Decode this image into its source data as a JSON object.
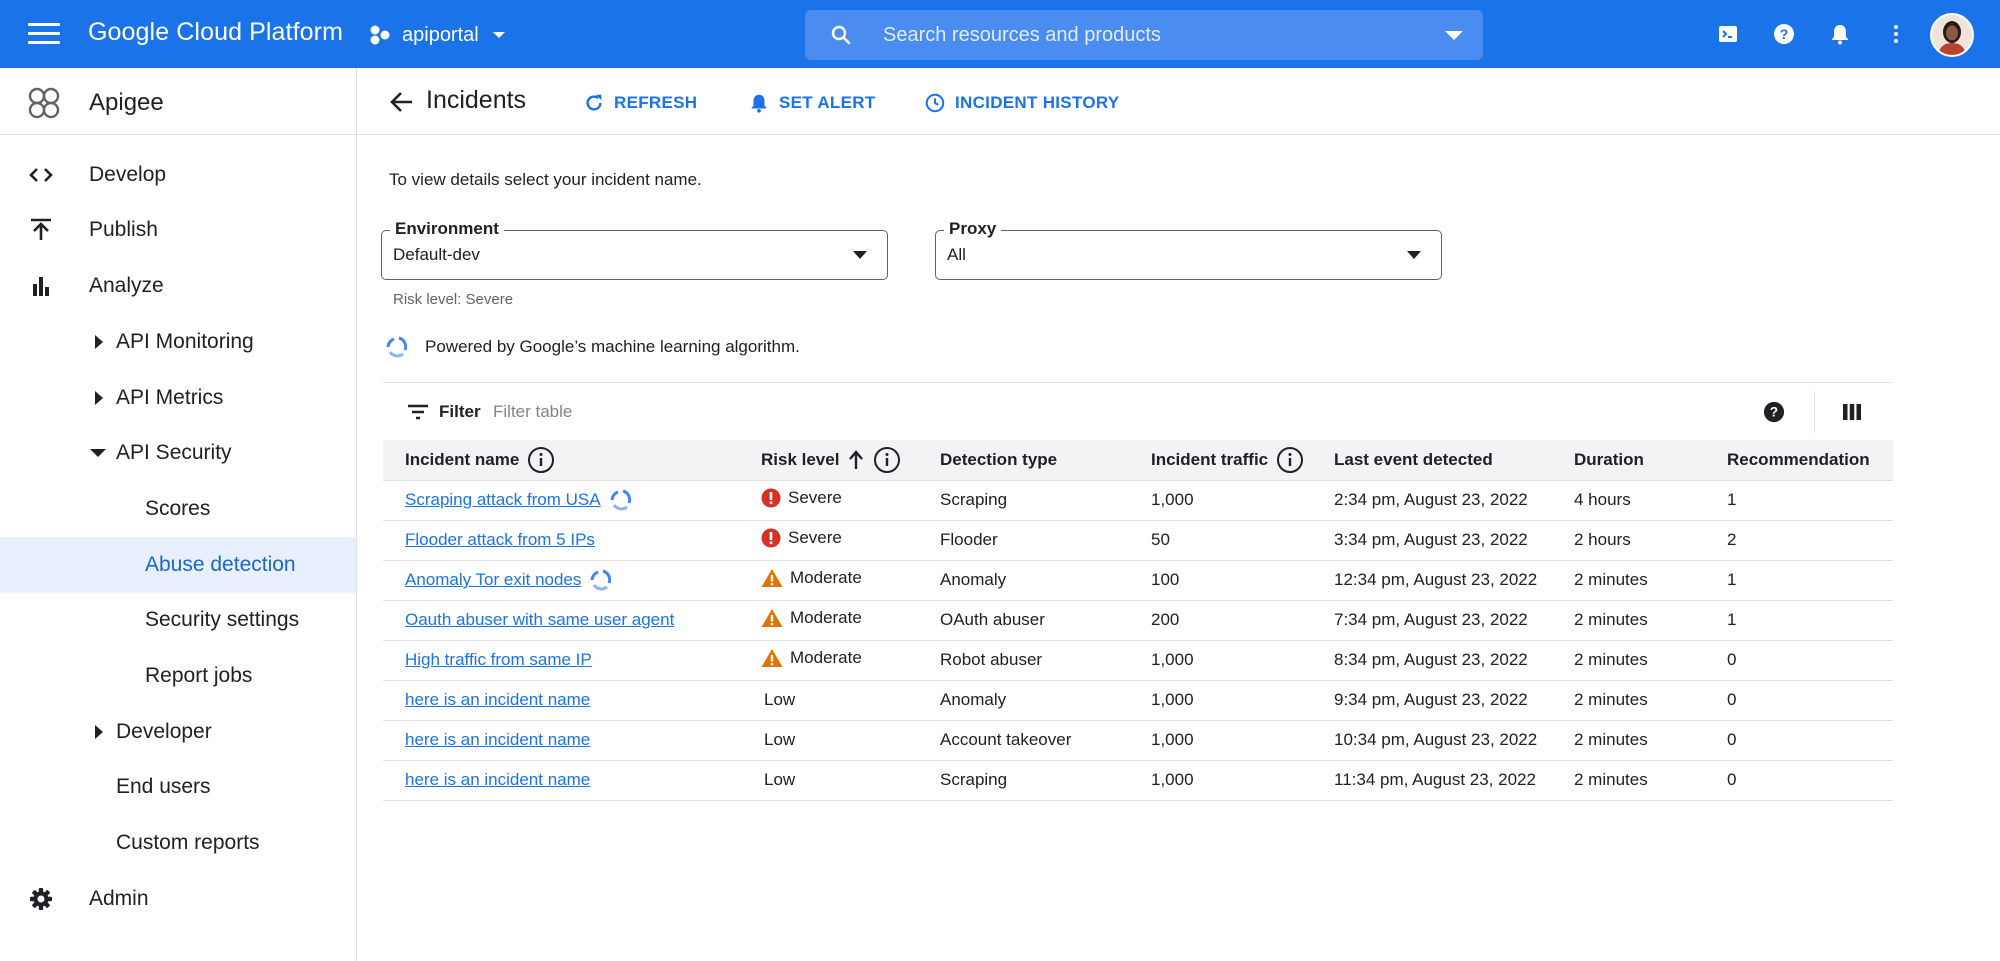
{
  "topbar": {
    "brand": "Google Cloud Platform",
    "project": "apiportal",
    "search_placeholder": "Search resources and products"
  },
  "sidebar": {
    "title": "Apigee",
    "items": [
      {
        "label": "Develop",
        "icon": "code-icon"
      },
      {
        "label": "Publish",
        "icon": "publish-icon"
      },
      {
        "label": "Analyze",
        "icon": "bar-chart-icon"
      },
      {
        "label": "API Monitoring",
        "arrow": "right"
      },
      {
        "label": "API Metrics",
        "arrow": "right"
      },
      {
        "label": "API Security",
        "arrow": "down"
      },
      {
        "label": "Scores"
      },
      {
        "label": "Abuse detection",
        "active": true
      },
      {
        "label": "Security settings"
      },
      {
        "label": "Report jobs"
      },
      {
        "label": "Developer",
        "arrow": "right"
      },
      {
        "label": "End users"
      },
      {
        "label": "Custom reports"
      },
      {
        "label": "Admin",
        "icon": "gear-icon"
      }
    ]
  },
  "header": {
    "title": "Incidents",
    "refresh": "REFRESH",
    "set_alert": "SET ALERT",
    "incident_history": "INCIDENT HISTORY"
  },
  "intro": "To view details  select your incident name.",
  "environment": {
    "label": "Environment",
    "value": "Default-dev",
    "helper": "Risk level: Severe"
  },
  "proxy": {
    "label": "Proxy",
    "value": "All"
  },
  "ml_note": "Powered by Google’s machine learning algorithm.",
  "table": {
    "filter_label": "Filter",
    "filter_placeholder": "Filter table",
    "columns": [
      "Incident name",
      "Risk level",
      "Detection type",
      "Incident traffic",
      "Last event detected",
      "Duration",
      "Recommendation"
    ],
    "rows": [
      {
        "name": "Scraping attack from USA",
        "ml": true,
        "risk": "Severe",
        "type": "Scraping",
        "traffic": "1,000",
        "last": "2:34 pm, August 23, 2022",
        "duration": "4 hours",
        "rec": "1"
      },
      {
        "name": "Flooder attack from  5 IPs",
        "ml": false,
        "risk": "Severe",
        "type": "Flooder",
        "traffic": "50",
        "last": "3:34 pm, August 23, 2022",
        "duration": "2 hours",
        "rec": "2"
      },
      {
        "name": "Anomaly Tor exit nodes",
        "ml": true,
        "risk": "Moderate",
        "type": "Anomaly",
        "traffic": "100",
        "last": "12:34 pm, August 23, 2022",
        "duration": "2 minutes",
        "rec": "1"
      },
      {
        "name": "Oauth abuser with same user agent",
        "ml": false,
        "risk": "Moderate",
        "type": "OAuth abuser",
        "traffic": "200",
        "last": "7:34 pm, August 23, 2022",
        "duration": "2 minutes",
        "rec": "1"
      },
      {
        "name": "High traffic from same IP",
        "ml": false,
        "risk": "Moderate",
        "type": "Robot abuser",
        "traffic": "1,000",
        "last": "8:34 pm, August 23, 2022",
        "duration": "2 minutes",
        "rec": "0"
      },
      {
        "name": "here is an incident name",
        "ml": false,
        "risk": "Low",
        "type": "Anomaly",
        "traffic": "1,000",
        "last": "9:34 pm, August 23, 2022",
        "duration": "2 minutes",
        "rec": "0"
      },
      {
        "name": "here is an incident name",
        "ml": false,
        "risk": "Low",
        "type": "Account takeover",
        "traffic": "1,000",
        "last": "10:34 pm, August 23, 2022",
        "duration": "2 minutes",
        "rec": "0"
      },
      {
        "name": "here is an incident name",
        "ml": false,
        "risk": "Low",
        "type": "Scraping",
        "traffic": "1,000",
        "last": "11:34 pm, August 23, 2022",
        "duration": "2 minutes",
        "rec": "0"
      }
    ]
  },
  "colors": {
    "primary": "#1a73e8",
    "severe": "#d93025",
    "moderate": "#e37400",
    "active_bg": "#e8f0fe"
  }
}
